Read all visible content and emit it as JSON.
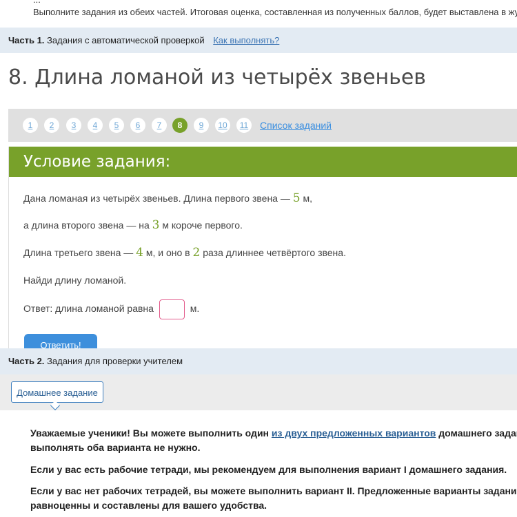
{
  "intro": {
    "cut_line": "...",
    "text": "Выполните задания из обеих частей. Итоговая оценка, составленная из полученных баллов, будет выставлена в журнал."
  },
  "part1": {
    "label": "Часть 1.",
    "text": "Задания с автоматической проверкой",
    "help_link": "Как выполнять?"
  },
  "task": {
    "title": "8. Длина ломаной из четырёх звеньев"
  },
  "pager": {
    "pages": [
      "1",
      "2",
      "3",
      "4",
      "5",
      "6",
      "7",
      "8",
      "9",
      "10",
      "11"
    ],
    "active": "8",
    "list_link": "Список заданий"
  },
  "condition": {
    "heading": "Условие задания:",
    "line1_a": "Дана ломаная из четырёх звеньев. Длина первого звена —",
    "line1_num": "5",
    "line1_b": "м,",
    "line2_a": "а длина второго звена — на",
    "line2_num": "3",
    "line2_b": "м короче первого.",
    "line3_a": "Длина третьего звена —",
    "line3_num1": "4",
    "line3_b": "м, и оно в",
    "line3_num2": "2",
    "line3_c": "раза длиннее четвёртого звена.",
    "line4": "Найди длину ломаной.",
    "answer_label": "Ответ: длина ломаной равна",
    "answer_value": "",
    "answer_unit": "м.",
    "submit_label": "Ответить!"
  },
  "part2": {
    "label": "Часть 2.",
    "text": "Задания для проверки учителем"
  },
  "homework": {
    "tab_label": "Домашнее задание",
    "p1_a": "Уважаемые ученики! Вы можете выполнить один",
    "p1_link": "из двух предложенных вариантов",
    "p1_b": "домашнего задания,",
    "p1_line2": "выполнять оба варианта не нужно.",
    "p2": "Если у вас есть рабочие тетради, мы рекомендуем для выполнения вариант I домашнего задания.",
    "p3_line1": "Если у вас нет рабочих тетрадей, вы можете выполнить вариант II. Предложенные варианты заданий",
    "p3_line2": "равноценны и составлены для вашего удобства."
  },
  "colors": {
    "accent_green": "#78a12a",
    "link_blue": "#3a8ee0",
    "section_bg": "#e3ebf3",
    "button_blue": "#3d8fdc",
    "input_border": "#e35c8c"
  }
}
